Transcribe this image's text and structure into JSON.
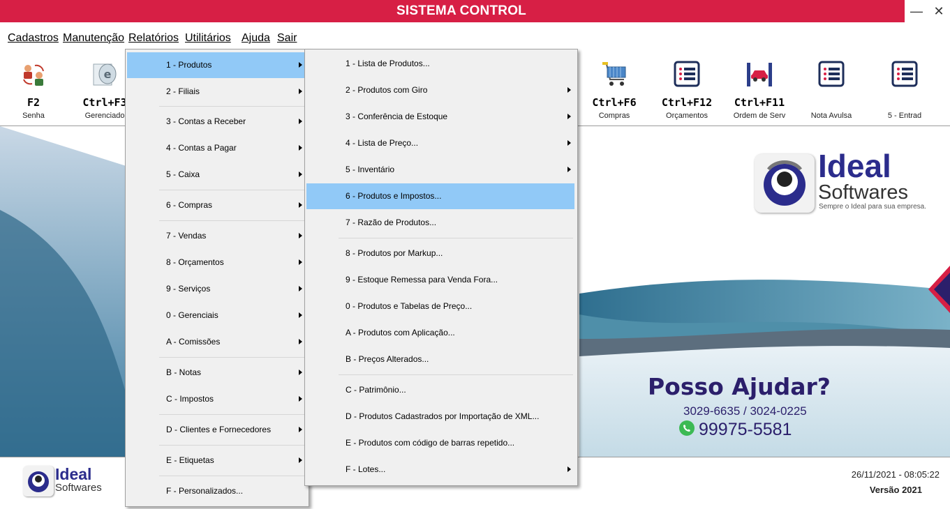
{
  "window": {
    "title": "SISTEMA CONTROL",
    "minimize": "—",
    "close": "✕"
  },
  "menubar": [
    {
      "label": "Cadastros"
    },
    {
      "label": "Manutenção"
    },
    {
      "label": "Relatórios"
    },
    {
      "label": "Utilitários"
    },
    {
      "label": "Ajuda"
    },
    {
      "label": "Sair"
    }
  ],
  "toolbar": [
    {
      "key": "F2",
      "label": "Senha",
      "icon": "users-swap-icon"
    },
    {
      "key": "Ctrl+F3",
      "label": "Gerenciado",
      "icon": "nfe-icon"
    },
    {
      "key": "Ctrl+F6",
      "label": "Compras",
      "icon": "shopping-cart-icon"
    },
    {
      "key": "Ctrl+F12",
      "label": "Orçamentos",
      "icon": "list-document-icon"
    },
    {
      "key": "Ctrl+F11",
      "label": "Ordem de Serv",
      "icon": "car-lift-icon"
    },
    {
      "key": "",
      "label": "Nota Avulsa",
      "icon": "list-document-icon"
    },
    {
      "key": "",
      "label": "5 - Entrad",
      "icon": "list-document-icon"
    }
  ],
  "reports_menu": [
    {
      "label": "1 - Produtos",
      "submenu": true
    },
    {
      "label": "2 - Filiais",
      "submenu": true
    },
    {
      "label": "3 - Contas a Receber",
      "submenu": true
    },
    {
      "label": "4 - Contas a Pagar",
      "submenu": true
    },
    {
      "label": "5 - Caixa",
      "submenu": true
    },
    {
      "label": "6 - Compras",
      "submenu": true
    },
    {
      "label": "7 - Vendas",
      "submenu": true
    },
    {
      "label": "8 - Orçamentos",
      "submenu": true
    },
    {
      "label": "9 - Serviços",
      "submenu": true
    },
    {
      "label": "0 - Gerenciais",
      "submenu": true
    },
    {
      "label": "A - Comissões",
      "submenu": true
    },
    {
      "label": "B - Notas",
      "submenu": true
    },
    {
      "label": "C - Impostos",
      "submenu": true
    },
    {
      "label": "D - Clientes e Fornecedores",
      "submenu": true
    },
    {
      "label": "E - Etiquetas",
      "submenu": true
    },
    {
      "label": "F - Personalizados...",
      "submenu": false
    }
  ],
  "products_menu": [
    {
      "label": "1 - Lista de Produtos...",
      "submenu": false
    },
    {
      "label": "2 - Produtos com Giro",
      "submenu": true
    },
    {
      "label": "3 - Conferência de Estoque",
      "submenu": true
    },
    {
      "label": "4 - Lista de Preço...",
      "submenu": true
    },
    {
      "label": "5 - Inventário",
      "submenu": true
    },
    {
      "label": "6 - Produtos e Impostos...",
      "submenu": false
    },
    {
      "label": "7 - Razão de Produtos...",
      "submenu": false
    },
    {
      "label": "8 - Produtos por Markup...",
      "submenu": false
    },
    {
      "label": "9 - Estoque Remessa para Venda Fora...",
      "submenu": false
    },
    {
      "label": "0 - Produtos e Tabelas de Preço...",
      "submenu": false
    },
    {
      "label": "A - Produtos com Aplicação...",
      "submenu": false
    },
    {
      "label": "B - Preços Alterados...",
      "submenu": false
    },
    {
      "label": "C - Patrimônio...",
      "submenu": false
    },
    {
      "label": "D - Produtos Cadastrados por Importação de XML...",
      "submenu": false
    },
    {
      "label": "E - Produtos com código de barras repetido...",
      "submenu": false
    },
    {
      "label": "F - Lotes...",
      "submenu": true
    }
  ],
  "brand": {
    "name1": "Ideal",
    "name2": "Softwares",
    "tagline": "Sempre o Ideal para sua empresa."
  },
  "contact": {
    "headline": "Posso Ajudar?",
    "phones": "3029-6635 / 3024-0225",
    "whatsapp": "99975-5581"
  },
  "footer": {
    "datetime": "26/11/2021 - 08:05:22",
    "version": "Versão 2021",
    "logo1": "Ideal",
    "logo2": "Softwares"
  },
  "colors": {
    "title_bar": "#d71f45",
    "highlight": "#91c9f7",
    "brand_navy": "#2b1f6b"
  }
}
